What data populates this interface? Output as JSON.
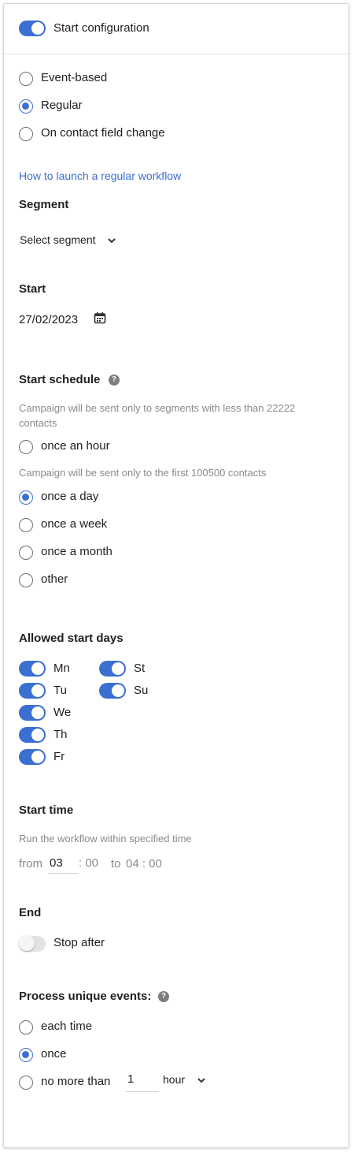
{
  "header": {
    "title": "Start configuration",
    "enabled": true
  },
  "trigger": {
    "options": [
      "Event-based",
      "Regular",
      "On contact field change"
    ],
    "selected": "Regular"
  },
  "help_link": "How to launch a regular workflow",
  "segment": {
    "heading": "Segment",
    "value": "Select segment"
  },
  "start": {
    "heading": "Start",
    "date": "27/02/2023"
  },
  "schedule": {
    "heading": "Start schedule",
    "note_hourly": "Campaign will be sent only to segments with less than 22222 contacts",
    "note_other": "Campaign will be sent only to the first 100500 contacts",
    "options": [
      "once an hour",
      "once a day",
      "once a week",
      "once a month",
      "other"
    ],
    "selected": "once a day"
  },
  "days": {
    "heading": "Allowed start days",
    "items": [
      {
        "label": "Mn",
        "on": true
      },
      {
        "label": "Tu",
        "on": true
      },
      {
        "label": "We",
        "on": true
      },
      {
        "label": "Th",
        "on": true
      },
      {
        "label": "Fr",
        "on": true
      },
      {
        "label": "St",
        "on": true
      },
      {
        "label": "Su",
        "on": true
      }
    ]
  },
  "start_time": {
    "heading": "Start time",
    "hint": "Run the workflow within specified time",
    "from_label": "from",
    "from_hour": "03",
    "from_minutes": ": 00",
    "to_label": "to",
    "to_value": "04 : 00"
  },
  "end": {
    "heading": "End",
    "toggle_label": "Stop after",
    "enabled": false
  },
  "unique": {
    "heading": "Process unique events:",
    "options": [
      "each time",
      "once",
      "no more than"
    ],
    "selected": "once",
    "limit_value": "1",
    "limit_unit": "hour"
  },
  "colors": {
    "accent": "#3b6fd1",
    "hint": "#8a8a8a",
    "toggle_off": "#e3e3e3"
  }
}
